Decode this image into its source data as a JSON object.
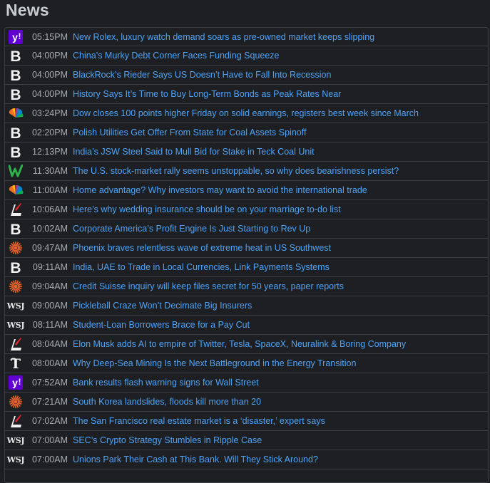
{
  "header": {
    "title": "News"
  },
  "news": [
    {
      "time": "05:15PM",
      "headline": "New Rolex, luxury watch demand soars as pre-owned market keeps slipping",
      "source_icon": "yahoo-icon"
    },
    {
      "time": "04:00PM",
      "headline": "China’s Murky Debt Corner Faces Funding Squeeze",
      "source_icon": "bloomberg-icon"
    },
    {
      "time": "04:00PM",
      "headline": "BlackRock’s Rieder Says US Doesn’t Have to Fall Into Recession",
      "source_icon": "bloomberg-icon"
    },
    {
      "time": "04:00PM",
      "headline": "History Says It’s Time to Buy Long-Term Bonds as Peak Rates Near",
      "source_icon": "bloomberg-icon"
    },
    {
      "time": "03:24PM",
      "headline": "Dow closes 100 points higher Friday on solid earnings, registers best week since March",
      "source_icon": "cnbc-peacock-icon"
    },
    {
      "time": "02:20PM",
      "headline": "Polish Utilities Get Offer From State for Coal Assets Spinoff",
      "source_icon": "bloomberg-icon"
    },
    {
      "time": "12:13PM",
      "headline": "India’s JSW Steel Said to Mull Bid for Stake in Teck Coal Unit",
      "source_icon": "bloomberg-icon"
    },
    {
      "time": "11:30AM",
      "headline": "The U.S. stock-market rally seems unstoppable, so why does bearishness persist?",
      "source_icon": "marketwatch-icon"
    },
    {
      "time": "11:00AM",
      "headline": "Home advantage? Why investors may want to avoid the international trade",
      "source_icon": "cnbc-peacock-icon"
    },
    {
      "time": "10:06AM",
      "headline": "Here’s why wedding insurance should be on your marriage to-do list",
      "source_icon": "lightning-icon"
    },
    {
      "time": "10:02AM",
      "headline": "Corporate America’s Profit Engine Is Just Starting to Rev Up",
      "source_icon": "bloomberg-icon"
    },
    {
      "time": "09:47AM",
      "headline": "Phoenix braves relentless wave of extreme heat in US Southwest",
      "source_icon": "sunburst-icon"
    },
    {
      "time": "09:11AM",
      "headline": "India, UAE to Trade in Local Currencies, Link Payments Systems",
      "source_icon": "bloomberg-icon"
    },
    {
      "time": "09:04AM",
      "headline": "Credit Suisse inquiry will keep files secret for 50 years, paper reports",
      "source_icon": "sunburst-icon"
    },
    {
      "time": "09:00AM",
      "headline": "Pickleball Craze Won’t Decimate Big Insurers",
      "source_icon": "wsj-icon",
      "wsj_text": "WSJ"
    },
    {
      "time": "08:11AM",
      "headline": "Student-Loan Borrowers Brace for a Pay Cut",
      "source_icon": "wsj-icon",
      "wsj_text": "WSJ"
    },
    {
      "time": "08:04AM",
      "headline": "Elon Musk adds AI to empire of Twitter, Tesla, SpaceX, Neuralink & Boring Company",
      "source_icon": "lightning-icon"
    },
    {
      "time": "08:00AM",
      "headline": "Why Deep-Sea Mining Is the Next Battleground in the Energy Transition",
      "source_icon": "nyt-icon"
    },
    {
      "time": "07:52AM",
      "headline": "Bank results flash warning signs for Wall Street",
      "source_icon": "yahoo-icon"
    },
    {
      "time": "07:21AM",
      "headline": "South Korea landslides, floods kill more than 20",
      "source_icon": "sunburst-icon"
    },
    {
      "time": "07:02AM",
      "headline": "The San Francisco real estate market is a ‘disaster,’ expert says",
      "source_icon": "lightning-icon"
    },
    {
      "time": "07:00AM",
      "headline": "SEC’s Crypto Strategy Stumbles in Ripple Case",
      "source_icon": "wsj-icon",
      "wsj_text": "WSJ"
    },
    {
      "time": "07:00AM",
      "headline": "Unions Park Their Cash at This Bank. Will They Stick Around?",
      "source_icon": "wsj-icon",
      "wsj_text": "WSJ"
    }
  ],
  "colors": {
    "background": "#1d1f23",
    "link": "#4fa3f7",
    "time": "#a8abb1",
    "border": "#3a3d43",
    "yahoo_purple": "#6001d2"
  }
}
